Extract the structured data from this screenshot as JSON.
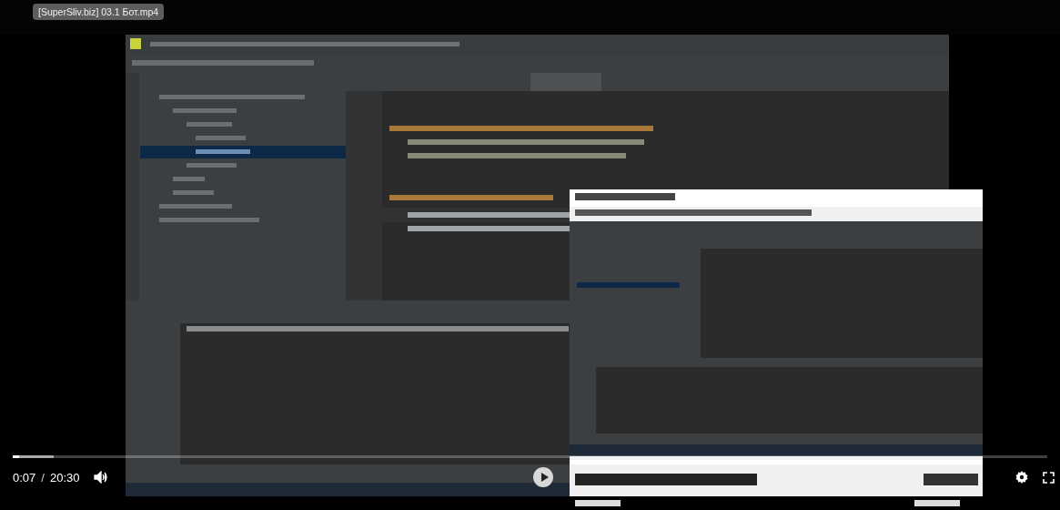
{
  "video": {
    "title": "[SuperSliv.biz] 03.1 Бот.mp4"
  },
  "player": {
    "paused": true,
    "progress": {
      "level": 0.006
    },
    "buffer": {
      "level": 0.04
    },
    "current_time": "0:07",
    "separator": "/",
    "duration": "20:30"
  }
}
